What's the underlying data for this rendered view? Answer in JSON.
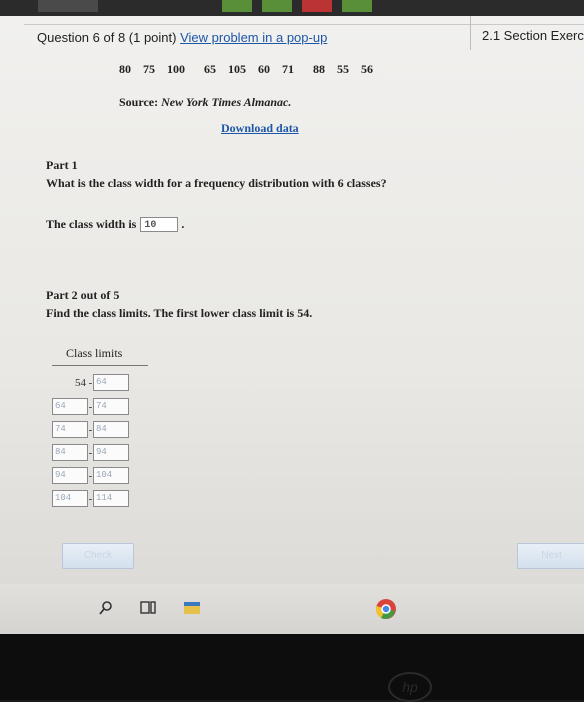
{
  "header": {
    "question": "Question 6 of 8 (1 point)",
    "popup_link": "View problem in a pop-up",
    "section": "2.1 Section Exerc"
  },
  "dataset": [
    "80",
    "75",
    "100",
    "65",
    "105",
    "60",
    "71",
    "88",
    "55",
    "56"
  ],
  "source": {
    "label": "Source:",
    "name": "New York Times Almanac.",
    "download": "Download data"
  },
  "part1": {
    "title": "Part 1",
    "question": "What is the class width for a frequency distribution with 6 classes?",
    "answer_label": "The class width is",
    "answer_value": "10",
    "answer_suffix": "."
  },
  "part2": {
    "title": "Part 2 out of 5",
    "question": "Find the class limits. The first lower class limit is 54.",
    "table_header": "Class limits",
    "rows": [
      {
        "lower": "54",
        "upper": "64"
      },
      {
        "lower": "64",
        "upper": "74"
      },
      {
        "lower": "74",
        "upper": "84"
      },
      {
        "lower": "84",
        "upper": "94"
      },
      {
        "lower": "94",
        "upper": "104"
      },
      {
        "lower": "104",
        "upper": "114"
      }
    ]
  },
  "buttons": {
    "check": "Check",
    "next": "Next"
  },
  "taskbar": {
    "icons": [
      "search-icon",
      "task-view-icon",
      "file-explorer-icon",
      "chrome-icon"
    ]
  },
  "colors": {
    "link": "#1d57a8",
    "input_text": "#9aa7b7"
  }
}
